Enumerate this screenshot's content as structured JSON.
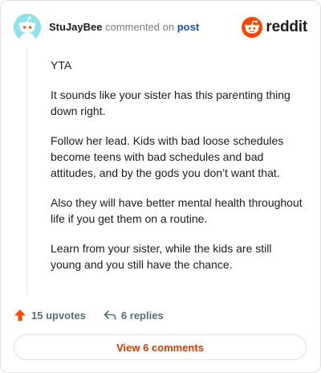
{
  "header": {
    "author": "StuJayBee",
    "action_text": "commented on",
    "post_link": "post",
    "brand": "reddit"
  },
  "comment": {
    "paragraphs": [
      "YTA",
      "It sounds like your sister has this parenting thing down right.",
      "Follow her lead. Kids with bad loose schedules become teens with bad schedules and bad attitudes, and by the gods you don’t want that.",
      "Also they will have better mental health throughout life if you get them on a routine.",
      "Learn from your sister, while the kids are still young and you still have the chance."
    ]
  },
  "actions": {
    "upvotes": "15 upvotes",
    "replies": "6 replies"
  },
  "footer": {
    "view_comments": "View 6 comments"
  },
  "colors": {
    "accent": "#d93a00",
    "upvote": "#ff4500",
    "link": "#1a4fb8",
    "avatar_bg": "#8fe3e8"
  },
  "icons": [
    "snoo-avatar-icon",
    "reddit-logo-icon",
    "upvote-arrow-icon",
    "reply-arrow-icon"
  ]
}
